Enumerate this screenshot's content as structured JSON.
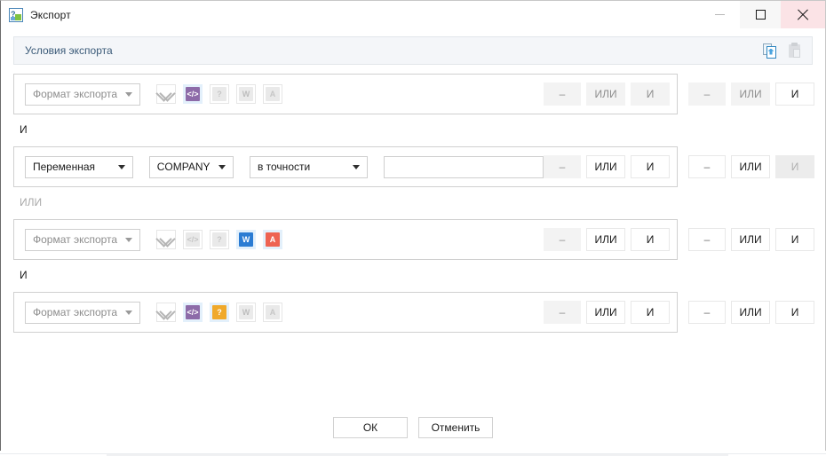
{
  "window": {
    "title": "Экспорт",
    "app_icon": "export-app-icon",
    "controls": {
      "minimize": "minimize-icon",
      "maximize": "maximize-icon",
      "close": "close-icon"
    }
  },
  "group": {
    "title": "Условия экспорта",
    "tools": [
      {
        "name": "copy-conditions-icon",
        "label": "copy",
        "enabled": true
      },
      {
        "name": "paste-conditions-icon",
        "label": "paste",
        "enabled": false
      }
    ]
  },
  "labels": {
    "minus": "–",
    "or": "ИЛИ",
    "and": "И"
  },
  "selects": {
    "format_label": "Формат экспорта",
    "variable_label": "Переменная",
    "company_value": "COMPANY",
    "operator_value": "в точности"
  },
  "input": {
    "value": "",
    "placeholder": ""
  },
  "format_icons": {
    "check_all": "✓",
    "code": "</>",
    "pdf_question": "?",
    "word": "W",
    "acrobat": "A"
  },
  "rows": [
    {
      "type": "format",
      "select": "Формат экспорта",
      "icons": [
        {
          "name": "check-all-icon",
          "glyph": "✓",
          "active": false
        },
        {
          "name": "xml-format-icon",
          "glyph": "</>",
          "active": true
        },
        {
          "name": "pdf-form-icon",
          "glyph": "?",
          "active": false
        },
        {
          "name": "word-format-icon",
          "glyph": "W",
          "active": false
        },
        {
          "name": "acrobat-format-icon",
          "glyph": "A",
          "active": false
        }
      ],
      "inner_ops": [
        {
          "label": "–",
          "state": "dim"
        },
        {
          "label": "ИЛИ",
          "state": "dim"
        },
        {
          "label": "И",
          "state": "dim"
        }
      ],
      "outer_ops": [
        {
          "label": "–",
          "state": "dim"
        },
        {
          "label": "ИЛИ",
          "state": "dim"
        },
        {
          "label": "И",
          "state": "normal"
        }
      ]
    },
    {
      "type": "variable",
      "select": "Переменная",
      "field": "COMPANY",
      "operator": "в точности",
      "value": "",
      "inner_ops": [
        {
          "label": "–",
          "state": "dim"
        },
        {
          "label": "ИЛИ",
          "state": "normal"
        },
        {
          "label": "И",
          "state": "normal"
        }
      ],
      "outer_ops": [
        {
          "label": "–",
          "state": "normal"
        },
        {
          "label": "ИЛИ",
          "state": "normal"
        },
        {
          "label": "И",
          "state": "disabled"
        }
      ]
    },
    {
      "type": "format",
      "select": "Формат экспорта",
      "icons": [
        {
          "name": "check-all-icon",
          "glyph": "✓",
          "active": false
        },
        {
          "name": "xml-format-icon",
          "glyph": "</>",
          "active": false
        },
        {
          "name": "pdf-form-icon",
          "glyph": "?",
          "active": false
        },
        {
          "name": "word-format-icon",
          "glyph": "W",
          "active": true
        },
        {
          "name": "acrobat-format-icon",
          "glyph": "A",
          "active": true
        }
      ],
      "inner_ops": [
        {
          "label": "–",
          "state": "dim"
        },
        {
          "label": "ИЛИ",
          "state": "normal"
        },
        {
          "label": "И",
          "state": "normal"
        }
      ],
      "outer_ops": [
        {
          "label": "–",
          "state": "normal"
        },
        {
          "label": "ИЛИ",
          "state": "normal"
        },
        {
          "label": "И",
          "state": "normal"
        }
      ]
    },
    {
      "type": "format",
      "select": "Формат экспорта",
      "icons": [
        {
          "name": "check-all-icon",
          "glyph": "✓",
          "active": false
        },
        {
          "name": "xml-format-icon",
          "glyph": "</>",
          "active": true
        },
        {
          "name": "pdf-form-icon",
          "glyph": "?",
          "active": true
        },
        {
          "name": "word-format-icon",
          "glyph": "W",
          "active": false
        },
        {
          "name": "acrobat-format-icon",
          "glyph": "A",
          "active": false
        }
      ],
      "inner_ops": [
        {
          "label": "–",
          "state": "dim"
        },
        {
          "label": "ИЛИ",
          "state": "normal"
        },
        {
          "label": "И",
          "state": "normal"
        }
      ],
      "outer_ops": [
        {
          "label": "–",
          "state": "normal"
        },
        {
          "label": "ИЛИ",
          "state": "normal"
        },
        {
          "label": "И",
          "state": "normal"
        }
      ]
    }
  ],
  "connectors": [
    {
      "label": "И",
      "style": "and"
    },
    {
      "label": "ИЛИ",
      "style": "or"
    },
    {
      "label": "И",
      "style": "and"
    }
  ],
  "footer": {
    "ok": "ОК",
    "cancel": "Отменить"
  },
  "colors": {
    "accent_header_text": "#3a5a78",
    "header_bg": "#f4f6f9",
    "icon_active_bg": "#e3f0fb",
    "code_purple": "#8d6ba8",
    "pdf_orange": "#f0a92b",
    "word_blue": "#2b7cd3",
    "acrobat_red": "#ee6352",
    "close_hover": "#fbe3e6"
  }
}
